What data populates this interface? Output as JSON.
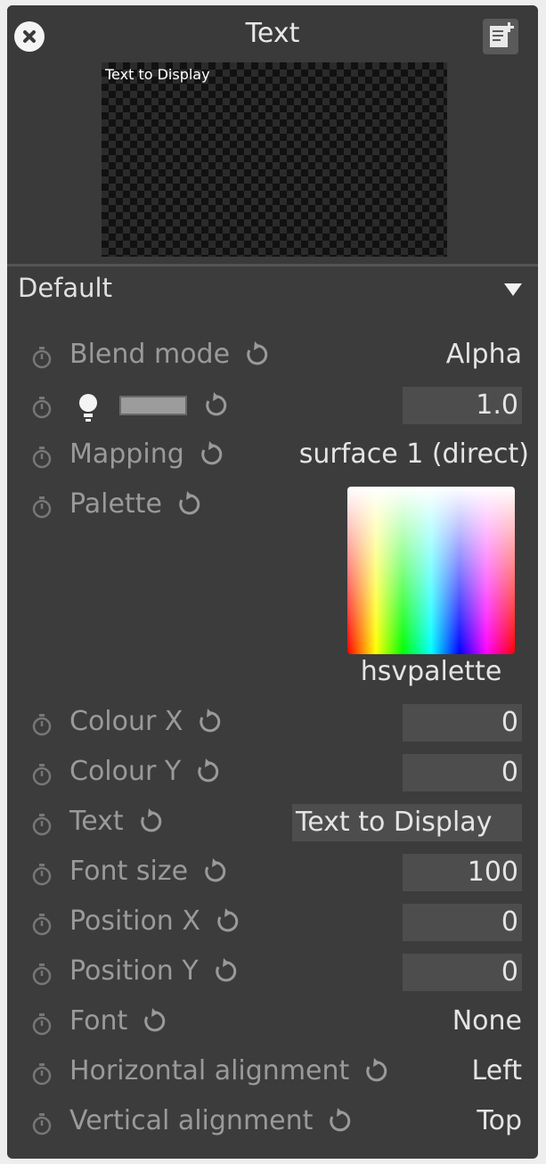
{
  "window": {
    "title": "Text"
  },
  "preview": {
    "text": "Text to Display"
  },
  "section": {
    "title": "Default"
  },
  "params": {
    "blend_mode": {
      "label": "Blend mode",
      "value": "Alpha"
    },
    "brightness": {
      "value": "1.0",
      "level": 1.0
    },
    "mapping": {
      "label": "Mapping",
      "value": "surface 1 (direct)"
    },
    "palette": {
      "label": "Palette",
      "name": "hsvpalette"
    },
    "colour_x": {
      "label": "Colour X",
      "value": "0"
    },
    "colour_y": {
      "label": "Colour Y",
      "value": "0"
    },
    "text": {
      "label": "Text",
      "value": "Text to Display"
    },
    "font_size": {
      "label": "Font size",
      "value": "100"
    },
    "position_x": {
      "label": "Position X",
      "value": "0"
    },
    "position_y": {
      "label": "Position Y",
      "value": "0"
    },
    "font": {
      "label": "Font",
      "value": "None"
    },
    "h_align": {
      "label": "Horizontal alignment",
      "value": "Left"
    },
    "v_align": {
      "label": "Vertical alignment",
      "value": "Top"
    }
  },
  "icons": {
    "close": "close-icon",
    "notes": "notes-icon",
    "timer": "timer-icon",
    "reset": "reset-icon",
    "brightness": "lightbulb-icon",
    "toggle": "triangle-down-icon"
  },
  "colors": {
    "panel": "#3c3c3c",
    "field": "#4d4d4d",
    "label": "#9a9a9a",
    "value": "#e4e4e4"
  }
}
